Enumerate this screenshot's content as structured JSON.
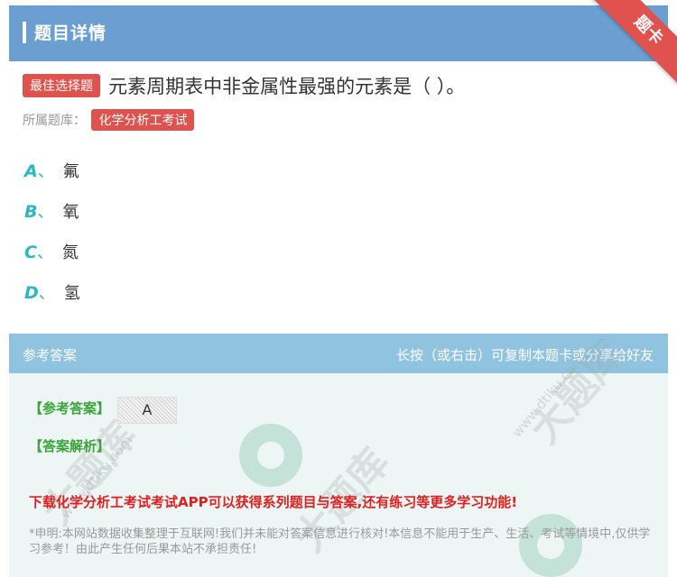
{
  "header": {
    "title": "题目详情",
    "ribbon": "题卡"
  },
  "question": {
    "tag": "最佳选择题",
    "text": "元素周期表中非金属性最强的元素是（ ）。",
    "bank_label": "所属题库：",
    "bank_name": "化学分析工考试"
  },
  "options": [
    {
      "letter": "A",
      "sep": "、",
      "text": "氟"
    },
    {
      "letter": "B",
      "sep": "、",
      "text": "氧"
    },
    {
      "letter": "C",
      "sep": "、",
      "text": "氮"
    },
    {
      "letter": "D",
      "sep": "、",
      "text": "氢"
    }
  ],
  "answer": {
    "section_title": "参考答案",
    "share_hint": "长按（或右击）可复制本题卡或分享给好友",
    "answer_label": "【参考答案】",
    "answer_value": "A",
    "analysis_label": "【答案解析】",
    "download_text": "下载化学分析工考试考试APP可以获得系列题目与答案,还有练习等更多学习功能!",
    "disclaimer": "*申明:本网站数据收集整理于互联网!我们并未能对答案信息进行核对!本信息不能用于生产、生活、考试等情境中,仅供学习参考！由此产生任何后果本站不承担责任!"
  },
  "watermark": {
    "brand": "大题库",
    "domain": "www.dtiku.com"
  },
  "colors": {
    "header": "#6b9fd1",
    "accent_red": "#e0524e",
    "option_letter": "#29b8c4",
    "answer_green": "#3aa33a",
    "download_red": "#e02020"
  }
}
